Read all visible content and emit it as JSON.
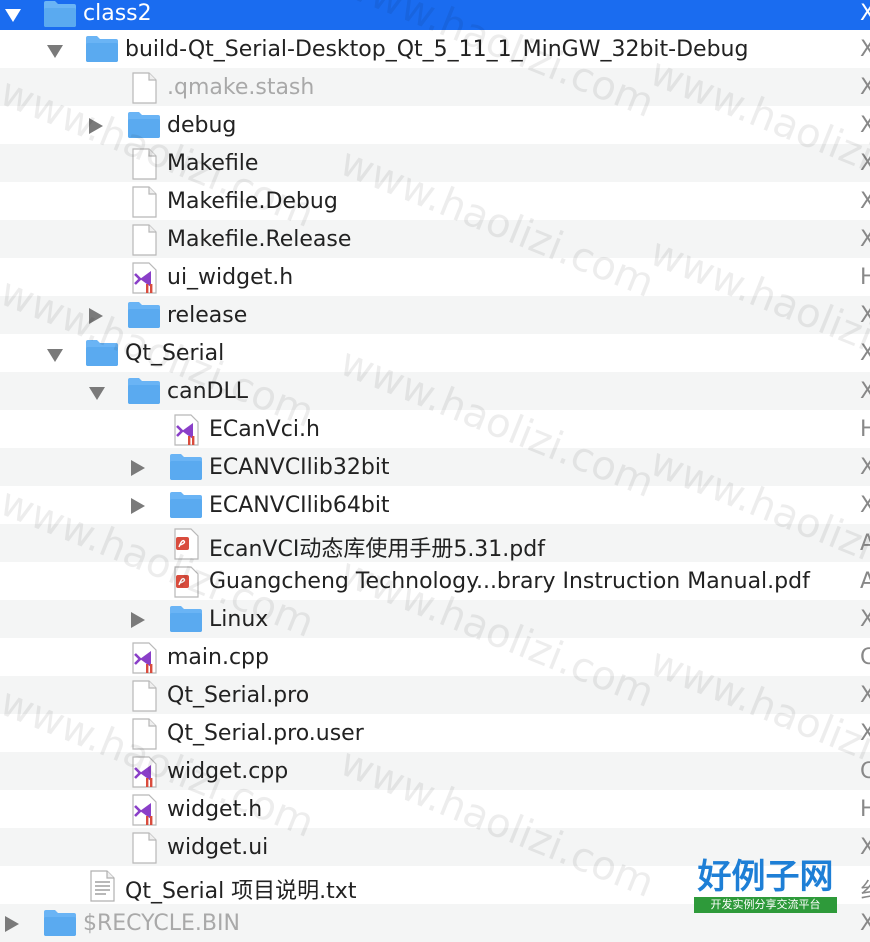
{
  "rows": [
    {
      "label": "class2",
      "depth": 0,
      "icon": "folder-icon",
      "disclosure": "expanded",
      "selected": true,
      "kind": "X"
    },
    {
      "label": "build-Qt_Serial-Desktop_Qt_5_11_1_MinGW_32bit-Debug",
      "depth": 1,
      "icon": "folder-icon",
      "disclosure": "expanded",
      "kind": "X"
    },
    {
      "label": ".qmake.stash",
      "depth": 2,
      "icon": "document-icon",
      "disclosure": "none",
      "dimmed": true,
      "kind": "X"
    },
    {
      "label": "debug",
      "depth": 2,
      "icon": "folder-icon",
      "disclosure": "collapsed",
      "kind": "X"
    },
    {
      "label": "Makefile",
      "depth": 2,
      "icon": "document-icon",
      "disclosure": "none",
      "kind": "X"
    },
    {
      "label": "Makefile.Debug",
      "depth": 2,
      "icon": "document-icon",
      "disclosure": "none",
      "kind": "X"
    },
    {
      "label": "Makefile.Release",
      "depth": 2,
      "icon": "document-icon",
      "disclosure": "none",
      "kind": "X"
    },
    {
      "label": "ui_widget.h",
      "depth": 2,
      "icon": "visual-studio-file-icon",
      "disclosure": "none",
      "kind": "H"
    },
    {
      "label": "release",
      "depth": 2,
      "icon": "folder-icon",
      "disclosure": "collapsed",
      "kind": "X"
    },
    {
      "label": "Qt_Serial",
      "depth": 1,
      "icon": "folder-icon",
      "disclosure": "expanded",
      "kind": "X"
    },
    {
      "label": "canDLL",
      "depth": 2,
      "icon": "folder-icon",
      "disclosure": "expanded",
      "kind": "X"
    },
    {
      "label": "ECanVci.h",
      "depth": 3,
      "icon": "visual-studio-file-icon",
      "disclosure": "none",
      "kind": "H"
    },
    {
      "label": "ECANVCIlib32bit",
      "depth": 3,
      "icon": "folder-icon",
      "disclosure": "collapsed",
      "kind": "X"
    },
    {
      "label": "ECANVCIlib64bit",
      "depth": 3,
      "icon": "folder-icon",
      "disclosure": "collapsed",
      "kind": "X"
    },
    {
      "label": "EcanVCI动态库使用手册5.31.pdf",
      "depth": 3,
      "icon": "pdf-file-icon",
      "disclosure": "none",
      "kind": "A"
    },
    {
      "label": "Guangcheng Technology...brary Instruction Manual.pdf",
      "depth": 3,
      "icon": "pdf-file-icon",
      "disclosure": "none",
      "kind": "A"
    },
    {
      "label": "Linux",
      "depth": 3,
      "icon": "folder-icon",
      "disclosure": "collapsed",
      "kind": "X"
    },
    {
      "label": "main.cpp",
      "depth": 2,
      "icon": "visual-studio-file-icon",
      "disclosure": "none",
      "kind": "C"
    },
    {
      "label": "Qt_Serial.pro",
      "depth": 2,
      "icon": "document-icon",
      "disclosure": "none",
      "kind": "X"
    },
    {
      "label": "Qt_Serial.pro.user",
      "depth": 2,
      "icon": "document-icon",
      "disclosure": "none",
      "kind": "X"
    },
    {
      "label": "widget.cpp",
      "depth": 2,
      "icon": "visual-studio-file-icon",
      "disclosure": "none",
      "kind": "C"
    },
    {
      "label": "widget.h",
      "depth": 2,
      "icon": "visual-studio-file-icon",
      "disclosure": "none",
      "kind": "H"
    },
    {
      "label": "widget.ui",
      "depth": 2,
      "icon": "document-icon",
      "disclosure": "none",
      "kind": "X"
    },
    {
      "label": "Qt_Serial 项目说明.txt",
      "depth": 1,
      "icon": "text-file-icon",
      "disclosure": "none",
      "kind": "纟"
    },
    {
      "label": "$RECYCLE.BIN",
      "depth": 0,
      "icon": "folder-icon",
      "disclosure": "collapsed",
      "dimmed": true,
      "kind": "X"
    }
  ],
  "watermark": {
    "text": "www.haolizi.com"
  },
  "logo": {
    "title": "好例子网",
    "subtitle": "开发实例分享交流平台"
  },
  "colors": {
    "selection": "#1a6cf0",
    "folder": "#5aaaf0",
    "alt_row": "#f4f5f5",
    "vs_purple": "#8a3fc8",
    "pdf_red": "#d94c3d"
  }
}
